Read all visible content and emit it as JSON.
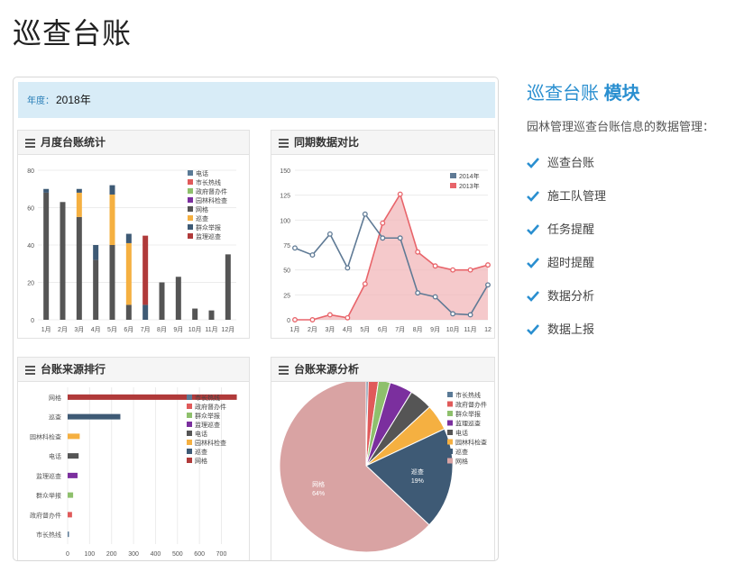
{
  "page": {
    "title": "巡查台账"
  },
  "filter": {
    "label": "年度：",
    "value": "2018年"
  },
  "sidebar": {
    "title": "巡查台账",
    "title_bold": "模块",
    "desc": "园林管理巡查台账信息的数据管理：",
    "items": [
      {
        "label": "巡查台账"
      },
      {
        "label": "施工队管理"
      },
      {
        "label": "任务提醒"
      },
      {
        "label": "超时提醒"
      },
      {
        "label": "数据分析"
      },
      {
        "label": "数据上报"
      }
    ]
  },
  "colors": {
    "accent": "#2a8fd0",
    "check": "#2a8fd0"
  },
  "panels": {
    "monthly": {
      "title": "月度台账统计"
    },
    "compare": {
      "title": "同期数据对比"
    },
    "ranking": {
      "title": "台账来源排行"
    },
    "source": {
      "title": "台账来源分析"
    }
  },
  "chart_data": [
    {
      "type": "bar",
      "title": "月度台账统计",
      "stacked": true,
      "categories": [
        "1月",
        "2月",
        "3月",
        "4月",
        "5月",
        "6月",
        "7月",
        "8月",
        "9月",
        "10月",
        "11月",
        "12月"
      ],
      "ylim": [
        0,
        80
      ],
      "yticks": [
        0,
        20,
        40,
        60,
        80
      ],
      "legend_position": "top-right",
      "series": [
        {
          "name": "电话",
          "color": "#5a7a96",
          "values": [
            0,
            0,
            0,
            0,
            0,
            0,
            0,
            0,
            0,
            0,
            0,
            0
          ]
        },
        {
          "name": "市长热线",
          "color": "#e05a5a",
          "values": [
            0,
            0,
            0,
            0,
            0,
            0,
            0,
            0,
            0,
            0,
            0,
            0
          ]
        },
        {
          "name": "政府督办件",
          "color": "#8ec06c",
          "values": [
            0,
            0,
            0,
            0,
            0,
            0,
            0,
            0,
            0,
            0,
            0,
            0
          ]
        },
        {
          "name": "园林科检查",
          "color": "#7b2f9e",
          "values": [
            0,
            0,
            0,
            0,
            0,
            0,
            0,
            0,
            0,
            0,
            0,
            0
          ]
        },
        {
          "name": "网格",
          "color": "#555555",
          "values": [
            68,
            63,
            55,
            32,
            40,
            8,
            0,
            20,
            23,
            6,
            5,
            35
          ]
        },
        {
          "name": "巡查",
          "color": "#f5b041",
          "values": [
            0,
            0,
            13,
            0,
            27,
            33,
            0,
            0,
            0,
            0,
            0,
            0
          ]
        },
        {
          "name": "群众举报",
          "color": "#3e5a75",
          "values": [
            2,
            0,
            2,
            8,
            5,
            5,
            8,
            0,
            0,
            0,
            0,
            0
          ]
        },
        {
          "name": "监理巡查",
          "color": "#b03a3a",
          "values": [
            0,
            0,
            0,
            0,
            0,
            0,
            37,
            0,
            0,
            0,
            0,
            0
          ]
        }
      ]
    },
    {
      "type": "line",
      "title": "同期数据对比",
      "categories": [
        "1月",
        "2月",
        "3月",
        "4月",
        "5月",
        "6月",
        "7月",
        "8月",
        "9月",
        "10月",
        "11月",
        "12"
      ],
      "ylim": [
        0,
        150
      ],
      "yticks": [
        0,
        25,
        50,
        75,
        100,
        125,
        150
      ],
      "legend_position": "top-right",
      "series": [
        {
          "name": "2014年",
          "color": "#5f7a95",
          "values": [
            72,
            65,
            86,
            52,
            106,
            82,
            82,
            27,
            23,
            6,
            5,
            35
          ]
        },
        {
          "name": "2013年",
          "color": "#e8646a",
          "values": [
            0,
            0,
            5,
            2,
            36,
            97,
            126,
            68,
            54,
            50,
            50,
            55
          ]
        }
      ]
    },
    {
      "type": "bar",
      "orientation": "horizontal",
      "title": "台账来源排行",
      "categories": [
        "网格",
        "巡查",
        "园林科检查",
        "电话",
        "监理巡查",
        "群众举报",
        "政府督办件",
        "市长热线"
      ],
      "values": [
        770,
        240,
        55,
        50,
        45,
        25,
        20,
        5
      ],
      "colors": [
        "#b03a3a",
        "#3e5a75",
        "#f5b041",
        "#555555",
        "#7b2f9e",
        "#8ec06c",
        "#e05a5a",
        "#5a7a96"
      ],
      "xlim": [
        0,
        780
      ],
      "xticks": [
        0,
        100,
        200,
        300,
        400,
        500,
        600,
        700
      ],
      "legend_position": "top-right",
      "legend": [
        {
          "name": "市长热线",
          "color": "#5a7a96"
        },
        {
          "name": "政府督办件",
          "color": "#e05a5a"
        },
        {
          "name": "群众举报",
          "color": "#8ec06c"
        },
        {
          "name": "监理巡查",
          "color": "#7b2f9e"
        },
        {
          "name": "电话",
          "color": "#555555"
        },
        {
          "name": "园林科检查",
          "color": "#f5b041"
        },
        {
          "name": "巡查",
          "color": "#3e5a75"
        },
        {
          "name": "网格",
          "color": "#b03a3a"
        }
      ]
    },
    {
      "type": "pie",
      "title": "台账来源分析",
      "legend_position": "top-right",
      "slices": [
        {
          "name": "市长热线",
          "value": 0.4,
          "color": "#5a7a96"
        },
        {
          "name": "政府督办件",
          "value": 1.9,
          "color": "#e05a5a"
        },
        {
          "name": "群众举报",
          "value": 2.2,
          "color": "#8ec06c"
        },
        {
          "name": "监理巡查",
          "value": 4.3,
          "color": "#7b2f9e"
        },
        {
          "name": "电话",
          "value": 4.3,
          "color": "#555555"
        },
        {
          "name": "园林科检查",
          "value": 4.9,
          "color": "#f5b041"
        },
        {
          "name": "巡查",
          "value": 19,
          "color": "#3e5a75",
          "label": "巡查",
          "pct": "19%"
        },
        {
          "name": "网格",
          "value": 63,
          "color": "#d9a3a3",
          "label": "网格",
          "pct": "64%"
        }
      ]
    }
  ]
}
